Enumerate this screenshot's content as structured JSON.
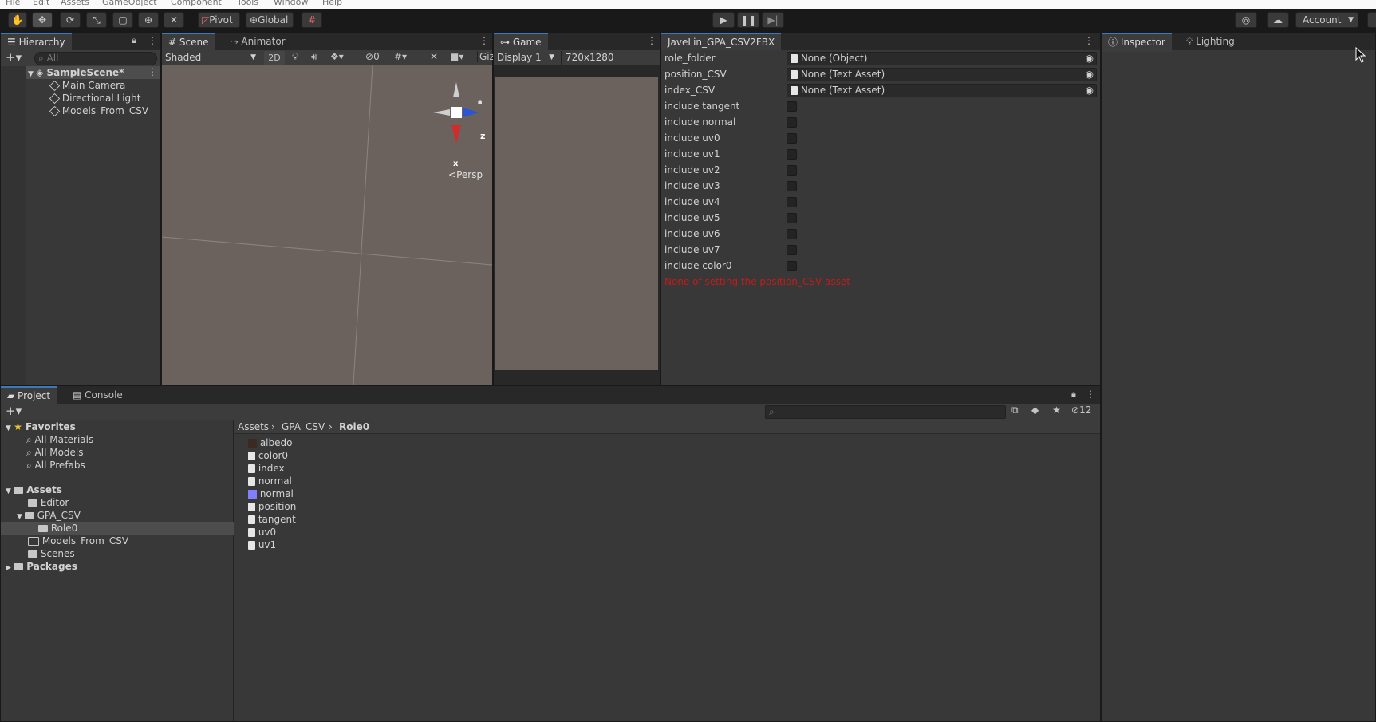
{
  "menu": [
    "File",
    "Edit",
    "Assets",
    "GameObject",
    "Component",
    "Tools",
    "Window",
    "Help"
  ],
  "toolbar": {
    "pivot_label": "Pivot",
    "global_label": "Global",
    "account_label": "Account"
  },
  "hierarchy": {
    "tab": "Hierarchy",
    "search_placeholder": "All",
    "scene": "SampleScene*",
    "objects": [
      "Main Camera",
      "Directional Light",
      "Models_From_CSV"
    ]
  },
  "scene_view": {
    "tab_scene": "Scene",
    "tab_animator": "Animator",
    "shading": "Shaded",
    "mode_2d": "2D",
    "hidden_count": "0",
    "gizmos_label": "Gizi",
    "gizmo_persp": "Persp",
    "axis_z": "z",
    "axis_x": "x"
  },
  "game_view": {
    "tab": "Game",
    "display": "Display 1",
    "resolution": "720x1280"
  },
  "tool_window": {
    "tab": "JaveLin_GPA_CSV2FBX",
    "fields": [
      {
        "label": "role_folder",
        "value": "None (Object)"
      },
      {
        "label": "position_CSV",
        "value": "None (Text Asset)"
      },
      {
        "label": "index_CSV",
        "value": "None (Text Asset)"
      }
    ],
    "toggles": [
      "include tangent",
      "include normal",
      "include uv0",
      "include uv1",
      "include uv2",
      "include uv3",
      "include uv4",
      "include uv5",
      "include uv6",
      "include uv7",
      "include color0"
    ],
    "error_text": "None of setting the position_CSV asset"
  },
  "inspector": {
    "tab_inspector": "Inspector",
    "tab_lighting": "Lighting"
  },
  "project": {
    "tab_project": "Project",
    "tab_console": "Console",
    "hidden_count": "12",
    "favorites_label": "Favorites",
    "favorites": [
      "All Materials",
      "All Models",
      "All Prefabs"
    ],
    "assets_label": "Assets",
    "asset_tree": [
      "Editor",
      "GPA_CSV",
      "Role0",
      "Models_From_CSV",
      "Scenes"
    ],
    "packages_label": "Packages",
    "breadcrumb": [
      "Assets",
      "GPA_CSV",
      "Role0"
    ],
    "files": [
      "albedo",
      "color0",
      "index",
      "normal",
      "normal",
      "position",
      "tangent",
      "uv0",
      "uv1"
    ]
  },
  "colors": {
    "selection": "#3a79bb",
    "error": "#c21b1b",
    "panel": "#383838"
  }
}
